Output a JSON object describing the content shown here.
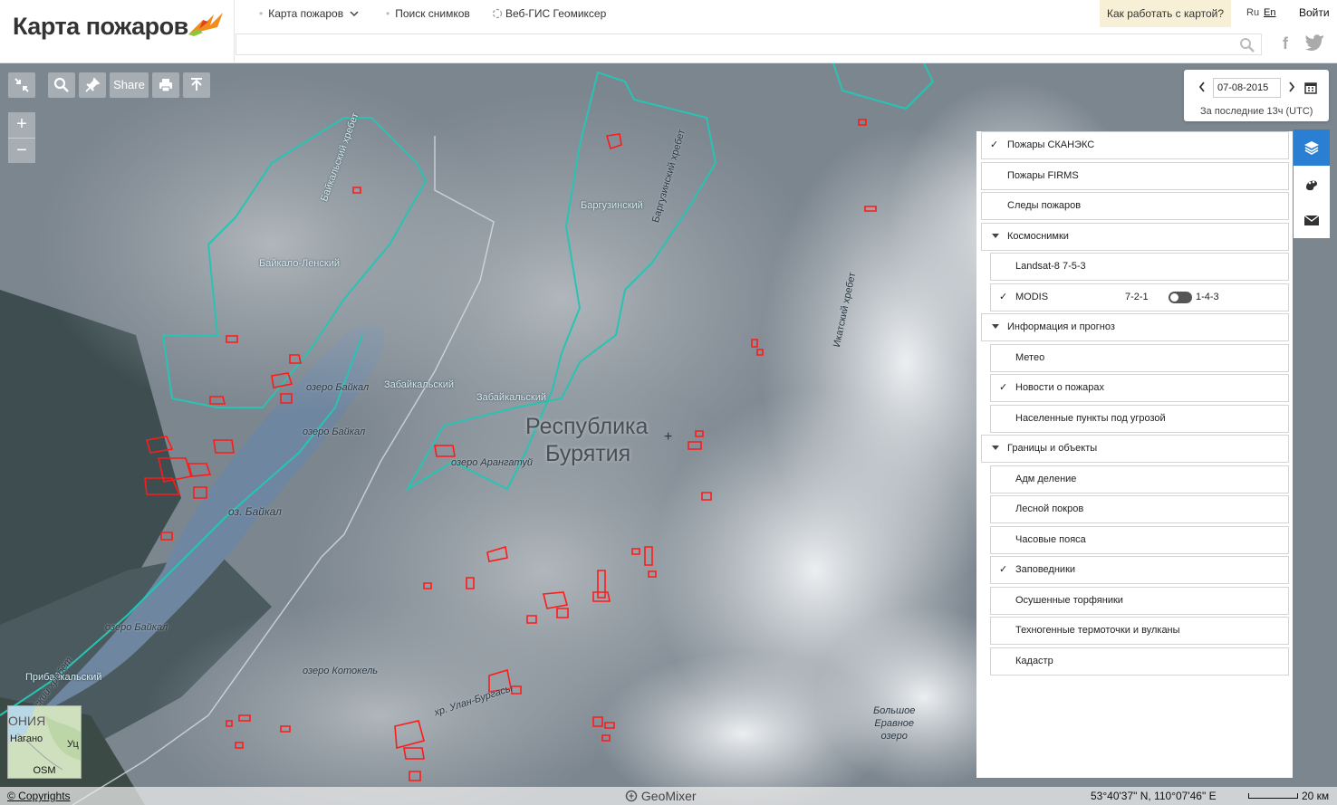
{
  "header": {
    "logo_text": "Карта пожаров",
    "nav": [
      {
        "label": "Карта пожаров",
        "icon": "chevron-down-icon"
      },
      {
        "label": "Поиск снимков"
      },
      {
        "label": "Веб-ГИС Геомиксер"
      }
    ],
    "help_label": "Как работать с картой?",
    "lang_ru": "Ru",
    "lang_en": "En",
    "login_label": "Войти",
    "search_placeholder": ""
  },
  "toolbar": {
    "share_label": "Share",
    "zoom_in": "+",
    "zoom_out": "−"
  },
  "date": {
    "value": "07-08-2015",
    "note": "За последние 13ч (UTC)"
  },
  "map_labels": {
    "baikalo_lensky": "Байкало-Ленский",
    "baykalsky_range": "Байкальский хребет",
    "barguzinsky": "Баргузинский",
    "barguzinsky_range": "Баргузинский хребет",
    "ikatsky_range": "Икатский хребет",
    "zabaikalsky_1": "Забайкальский",
    "zabaikalsky_2": "Забайкальский",
    "lake_baikal_1": "озеро Байкал",
    "lake_baikal_2": "озеро Байкал",
    "lake_baikal_3": "оз. Байкал",
    "lake_baikal_4": "озеро Байкал",
    "lake_arangatui": "озеро Арангатуй",
    "republic_line1": "Республика",
    "republic_line2": "Бурятия",
    "pribaikalsky": "Прибайкальский",
    "primorsky_range": "рский хребет",
    "lake_kotokel": "озеро Котокель",
    "ulan_burgasy": "хр. Улан-Бургасы",
    "bolshoe_eravnoe": "Большое\nЕравное\nозеро"
  },
  "layers": [
    {
      "label": "Пожары СКАНЭКС",
      "checked": true,
      "indent": 0,
      "group": false
    },
    {
      "label": "Пожары FIRMS",
      "checked": false,
      "indent": 0,
      "group": false
    },
    {
      "label": "Следы пожаров",
      "checked": false,
      "indent": 0,
      "group": false
    },
    {
      "label": "Космоснимки",
      "checked": false,
      "indent": 0,
      "group": true
    },
    {
      "label": "Landsat-8 7-5-3",
      "checked": false,
      "indent": 1,
      "group": false
    },
    {
      "label": "MODIS",
      "checked": true,
      "indent": 1,
      "group": false,
      "toggle_left": "7-2-1",
      "toggle_right": "1-4-3"
    },
    {
      "label": "Информация и прогноз",
      "checked": false,
      "indent": 0,
      "group": true
    },
    {
      "label": "Метео",
      "checked": false,
      "indent": 1,
      "group": false
    },
    {
      "label": "Новости о пожарах",
      "checked": true,
      "indent": 1,
      "group": false
    },
    {
      "label": "Населенные пункты под угрозой",
      "checked": false,
      "indent": 1,
      "group": false
    },
    {
      "label": "Границы и объекты",
      "checked": false,
      "indent": 0,
      "group": true
    },
    {
      "label": "Адм деление",
      "checked": false,
      "indent": 1,
      "group": false
    },
    {
      "label": "Лесной покров",
      "checked": false,
      "indent": 1,
      "group": false
    },
    {
      "label": "Часовые пояса",
      "checked": false,
      "indent": 1,
      "group": false
    },
    {
      "label": "Заповедники",
      "checked": true,
      "indent": 1,
      "group": false
    },
    {
      "label": "Осушенные торфяники",
      "checked": false,
      "indent": 1,
      "group": false
    },
    {
      "label": "Техногенные термоточки и вулканы",
      "checked": false,
      "indent": 1,
      "group": false
    },
    {
      "label": "Кадастр",
      "checked": false,
      "indent": 1,
      "group": false
    }
  ],
  "side_tabs": [
    {
      "icon": "layers-icon",
      "active": true
    },
    {
      "icon": "palette-icon",
      "active": false
    },
    {
      "icon": "envelope-icon",
      "active": false
    }
  ],
  "minimap": {
    "label": "OSM",
    "fragment_1": "ОНИЯ",
    "fragment_2": "Нагано",
    "fragment_3": "Уц"
  },
  "footer": {
    "copyrights": "© Copyrights",
    "brand": "GeoMixer",
    "coordinates": "53°40'37\" N, 110°07'46\" E",
    "scale": "20 км"
  },
  "colors": {
    "accent_blue": "#2b7fd2",
    "fire_outline": "#ff1a1a",
    "reserve_boundary": "#28c3b3",
    "help_bg": "#f7f0d6"
  }
}
